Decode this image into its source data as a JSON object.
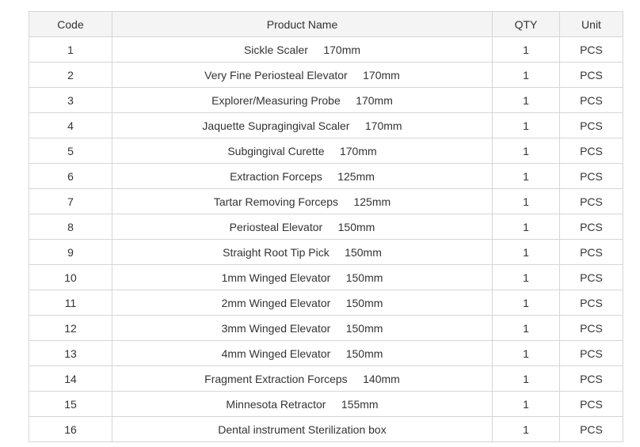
{
  "table": {
    "headers": {
      "code": "Code",
      "name": "Product Name",
      "qty": "QTY",
      "unit": "Unit"
    },
    "rows": [
      {
        "code": "1",
        "name": "Sickle Scaler     170mm",
        "qty": "1",
        "unit": "PCS"
      },
      {
        "code": "2",
        "name": "Very Fine Periosteal Elevator     170mm",
        "qty": "1",
        "unit": "PCS"
      },
      {
        "code": "3",
        "name": "Explorer/Measuring Probe     170mm",
        "qty": "1",
        "unit": "PCS"
      },
      {
        "code": "4",
        "name": "Jaquette Supragingival Scaler     170mm",
        "qty": "1",
        "unit": "PCS"
      },
      {
        "code": "5",
        "name": "Subgingival Curette     170mm",
        "qty": "1",
        "unit": "PCS"
      },
      {
        "code": "6",
        "name": "Extraction Forceps     125mm",
        "qty": "1",
        "unit": "PCS"
      },
      {
        "code": "7",
        "name": "Tartar Removing Forceps     125mm",
        "qty": "1",
        "unit": "PCS"
      },
      {
        "code": "8",
        "name": "Periosteal Elevator     150mm",
        "qty": "1",
        "unit": "PCS"
      },
      {
        "code": "9",
        "name": "Straight Root Tip Pick     150mm",
        "qty": "1",
        "unit": "PCS"
      },
      {
        "code": "10",
        "name": "1mm Winged Elevator     150mm",
        "qty": "1",
        "unit": "PCS"
      },
      {
        "code": "11",
        "name": "2mm Winged Elevator     150mm",
        "qty": "1",
        "unit": "PCS"
      },
      {
        "code": "12",
        "name": "3mm Winged Elevator     150mm",
        "qty": "1",
        "unit": "PCS"
      },
      {
        "code": "13",
        "name": "4mm Winged Elevator     150mm",
        "qty": "1",
        "unit": "PCS"
      },
      {
        "code": "14",
        "name": "Fragment Extraction Forceps     140mm",
        "qty": "1",
        "unit": "PCS"
      },
      {
        "code": "15",
        "name": "Minnesota Retractor     155mm",
        "qty": "1",
        "unit": "PCS"
      },
      {
        "code": "16",
        "name": "Dental instrument Sterilization box",
        "qty": "1",
        "unit": "PCS"
      }
    ]
  }
}
